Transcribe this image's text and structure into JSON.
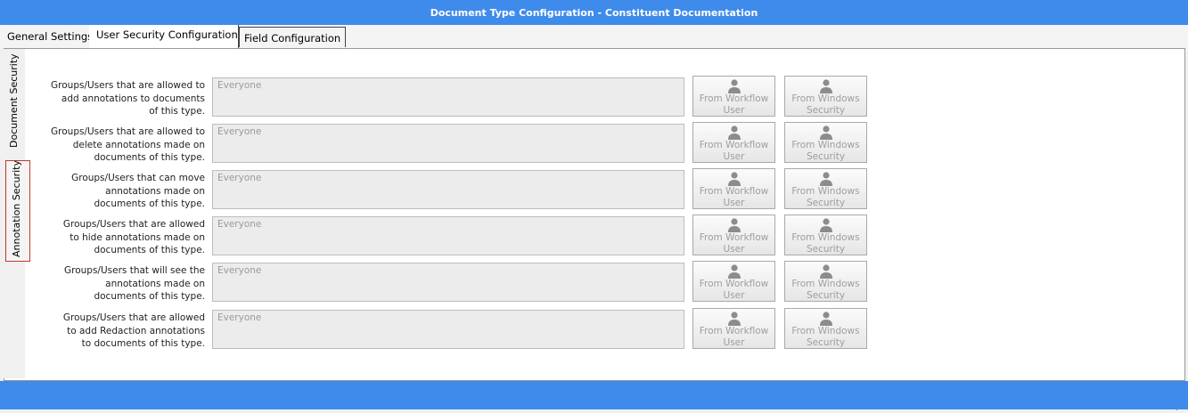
{
  "window": {
    "title": "Document Type Configuration - Constituent Documentation"
  },
  "tabs": [
    {
      "label": "General Settings"
    },
    {
      "label": "User Security Configuration",
      "active": true
    },
    {
      "label": "Field Configuration"
    }
  ],
  "side_tabs": [
    {
      "label": "Document Security"
    },
    {
      "label": "Annotation Security",
      "selected": true
    }
  ],
  "buttons": {
    "workflow_line1": "From Workflow",
    "workflow_line2": "User",
    "windows_line1": "From Windows",
    "windows_line2": "Security"
  },
  "rows": [
    {
      "label": [
        "Groups/Users that are allowed to",
        "add annotations to documents",
        "of this type."
      ],
      "value": "Everyone"
    },
    {
      "label": [
        "Groups/Users that are allowed to",
        "delete annotations made on",
        "documents of this type."
      ],
      "value": "Everyone"
    },
    {
      "label": [
        "Groups/Users that can move",
        "annotations made on",
        "documents of this type."
      ],
      "value": "Everyone"
    },
    {
      "label": [
        "Groups/Users that are allowed",
        "to hide annotations made on",
        "documents of this type."
      ],
      "value": "Everyone"
    },
    {
      "label": [
        "Groups/Users that will see the",
        "annotations made on",
        "documents of this type."
      ],
      "value": "Everyone"
    },
    {
      "label": [
        "Groups/Users that are allowed",
        "to add Redaction annotations",
        "to documents of this type."
      ],
      "value": "Everyone"
    }
  ],
  "colors": {
    "accent": "#3e8bec",
    "selected_border": "#c0392b"
  },
  "icons": {
    "user": "user-icon"
  }
}
